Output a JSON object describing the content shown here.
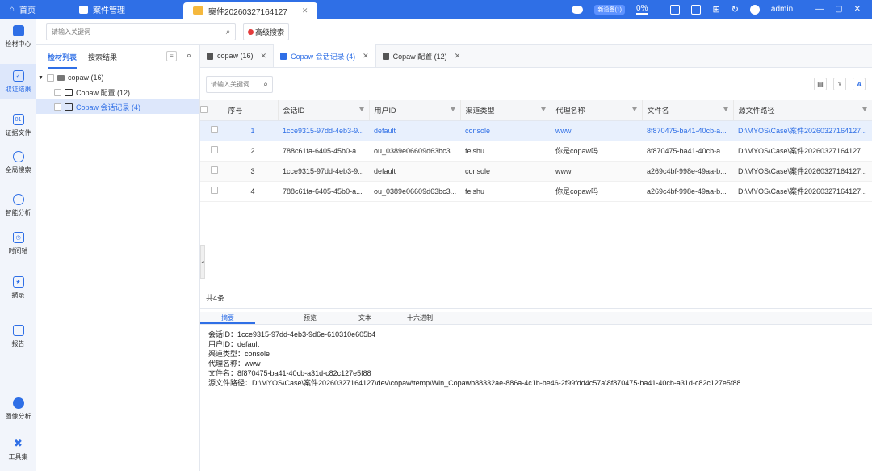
{
  "titlebar": {
    "home_label": "首页",
    "case_mgmt_label": "案件管理",
    "case_tab_label": "案件20260327164127",
    "new_device_label": "新设备(1)",
    "progress_label": "0%",
    "user_label": "admin"
  },
  "nav": [
    {
      "label": "检材中心"
    },
    {
      "label": "取证结果"
    },
    {
      "label": "证据文件"
    },
    {
      "label": "全局搜索"
    },
    {
      "label": "智能分析"
    },
    {
      "label": "时间轴"
    },
    {
      "label": "摘录"
    },
    {
      "label": "报告"
    },
    {
      "label": "图像分析"
    },
    {
      "label": "工具集"
    }
  ],
  "topsearch": {
    "placeholder": "请输入关键词",
    "advanced_label": "高级搜索"
  },
  "tree": {
    "tab_list": "检材列表",
    "tab_results": "搜索结果",
    "root_label": "copaw (16)",
    "children": [
      {
        "label": "Copaw 配置 (12)"
      },
      {
        "label": "Copaw 会话记录 (4)"
      }
    ]
  },
  "doc_tabs": [
    {
      "label": "copaw (16)"
    },
    {
      "label": "Copaw 会话记录 (4)"
    },
    {
      "label": "Copaw 配置 (12)"
    }
  ],
  "table_search": {
    "placeholder": "请输入关键词"
  },
  "table": {
    "headers": [
      "序号",
      "会话ID",
      "用户ID",
      "渠道类型",
      "代理名称",
      "文件名",
      "源文件路径"
    ],
    "rows": [
      [
        "1",
        "1cce9315-97dd-4eb3-9...",
        "default",
        "console",
        "www",
        "8f870475-ba41-40cb-a...",
        "D:\\MYOS\\Case\\案件20260327164127..."
      ],
      [
        "2",
        "788c61fa-6405-45b0-a...",
        "ou_0389e06609d63bc3...",
        "feishu",
        "你是copaw吗",
        "8f870475-ba41-40cb-a...",
        "D:\\MYOS\\Case\\案件20260327164127..."
      ],
      [
        "3",
        "1cce9315-97dd-4eb3-9...",
        "default",
        "console",
        "www",
        "a269c4bf-998e-49aa-b...",
        "D:\\MYOS\\Case\\案件20260327164127..."
      ],
      [
        "4",
        "788c61fa-6405-45b0-a...",
        "ou_0389e06609d63bc3...",
        "feishu",
        "你是copaw吗",
        "a269c4bf-998e-49aa-b...",
        "D:\\MYOS\\Case\\案件20260327164127..."
      ]
    ]
  },
  "total_label": "共4条",
  "detail_tabs": [
    "摘要",
    "预览",
    "文本",
    "十六进制"
  ],
  "detail_lines": [
    "会话ID：1cce9315-97dd-4eb3-9d6e-610310e605b4",
    "用户ID：default",
    "渠道类型：console",
    "代理名称：www",
    "文件名：8f870475-ba41-40cb-a31d-c82c127e5f88",
    "源文件路径：D:\\MYOS\\Case\\案件20260327164127\\dev\\copaw\\temp\\Win_Copawb88332ae-886a-4c1b-be46-2f99fdd4c57a\\8f870475-ba41-40cb-a31d-c82c127e5f88"
  ],
  "colors": {
    "accent": "#2f6fe6"
  }
}
